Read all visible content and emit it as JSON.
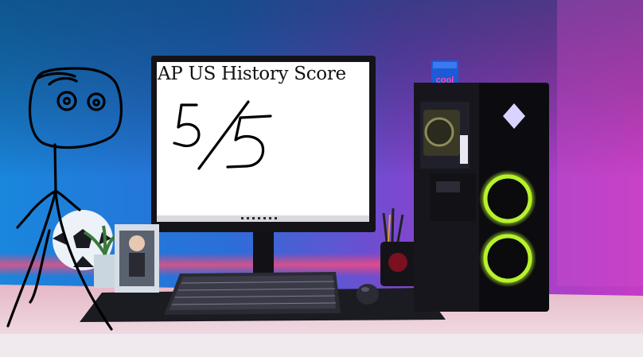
{
  "screen": {
    "title": "AP US History Score",
    "score_handwritten": "5/5"
  },
  "decor": {
    "can_text": "cool",
    "icons": [
      "stick-figure-icon",
      "pc-tower-logo-icon",
      "soccer-ball-icon",
      "plant-icon",
      "figure-box-icon"
    ]
  },
  "colors": {
    "wall_left": "#1f8fe0",
    "wall_right": "#c036c8",
    "desk": "#d9cfd8",
    "led_strip": "#ff4a6a",
    "fan_ring": "#b6f22a",
    "tower_logo": "#d9d4ff",
    "can": "#1d5ad6",
    "can_text": "#ff4aa8"
  }
}
